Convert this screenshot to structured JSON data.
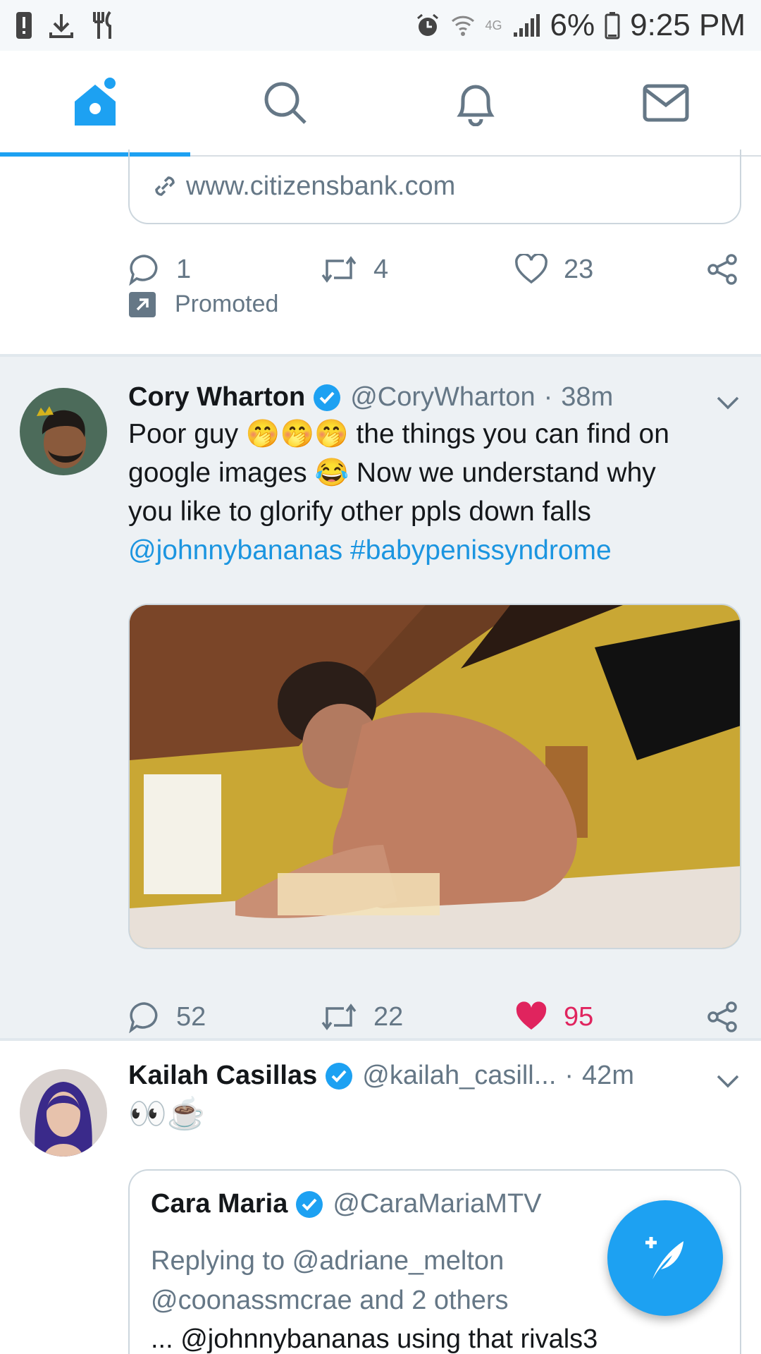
{
  "status_bar": {
    "network": "4G",
    "battery": "6%",
    "time": "9:25 PM"
  },
  "nav": {
    "tabs": [
      "home",
      "search",
      "notifications",
      "messages"
    ],
    "active": "home"
  },
  "promoted_tweet": {
    "link": "www.citizensbank.com",
    "replies": "1",
    "retweets": "4",
    "likes": "23",
    "promoted_label": "Promoted"
  },
  "tweets": [
    {
      "name": "Cory Wharton",
      "handle": "@CoryWharton",
      "separator": "·",
      "time": "38m",
      "text_line1": "Poor guy 🤭🤭🤭 the things you can find on",
      "text_line2": "google images 😂 Now we understand why",
      "text_line3": "you like to glorify other ppls down falls",
      "mention": "@johnnybananas",
      "hashtag": "#babypenissyndrome",
      "replies": "52",
      "retweets": "22",
      "likes": "95",
      "liked": true
    },
    {
      "name": "Kailah Casillas",
      "handle": "@kailah_casill...",
      "separator": "·",
      "time": "42m",
      "text": "👀☕",
      "quote": {
        "name": "Cara Maria",
        "handle": "@CaraMariaMTV",
        "reply_line1": "Replying to @adriane_melton",
        "reply_line2": "@coonassmcrae and 2 others",
        "text": "... @johnnybananas using that rivals3"
      }
    }
  ],
  "colors": {
    "accent": "#1da1f2",
    "like": "#e0245e",
    "secondary": "#657786"
  }
}
